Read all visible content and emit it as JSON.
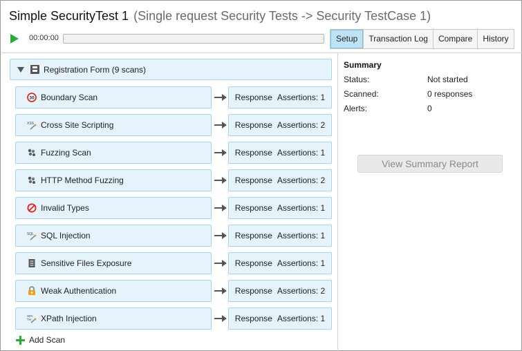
{
  "window": {
    "title": "Simple SecurityTest 1",
    "subtitle": "(Single request Security Tests -> Security TestCase 1)"
  },
  "toolbar": {
    "elapsed": "00:00:00",
    "progress": 0,
    "tabs": [
      {
        "label": "Setup",
        "active": true
      },
      {
        "label": "Transaction Log",
        "active": false
      },
      {
        "label": "Compare",
        "active": false
      },
      {
        "label": "History",
        "active": false
      }
    ]
  },
  "group": {
    "label": "Registration Form (9 scans)"
  },
  "scans": [
    {
      "name": "Boundary Scan",
      "icon": "boundary-icon",
      "response": "Response",
      "assertions": "Assertions: 1"
    },
    {
      "name": "Cross Site Scripting",
      "icon": "xss-icon",
      "response": "Response",
      "assertions": "Assertions: 2"
    },
    {
      "name": "Fuzzing Scan",
      "icon": "fuzzing-icon",
      "response": "Response",
      "assertions": "Assertions: 1"
    },
    {
      "name": "HTTP Method Fuzzing",
      "icon": "http-fuzzing-icon",
      "response": "Response",
      "assertions": "Assertions: 2"
    },
    {
      "name": "Invalid Types",
      "icon": "invalid-types-icon",
      "response": "Response",
      "assertions": "Assertions: 1"
    },
    {
      "name": "SQL Injection",
      "icon": "sql-icon",
      "response": "Response",
      "assertions": "Assertions: 1"
    },
    {
      "name": "Sensitive Files Exposure",
      "icon": "document-icon",
      "response": "Response",
      "assertions": "Assertions: 1"
    },
    {
      "name": "Weak Authentication",
      "icon": "weak-auth-icon",
      "response": "Response",
      "assertions": "Assertions: 2"
    },
    {
      "name": "XPath Injection",
      "icon": "xpath-icon",
      "response": "Response",
      "assertions": "Assertions: 1"
    }
  ],
  "add_scan": {
    "label": "Add Scan"
  },
  "summary": {
    "title": "Summary",
    "status_label": "Status:",
    "status_value": "Not started",
    "scanned_label": "Scanned:",
    "scanned_value": "0 responses",
    "alerts_label": "Alerts:",
    "alerts_value": "0",
    "report_button": "View Summary Report"
  },
  "colors": {
    "accent": "#bfe3f5",
    "row_bg": "#e6f3fb",
    "row_border": "#a9d3ee",
    "run_green": "#2eaa3c"
  }
}
